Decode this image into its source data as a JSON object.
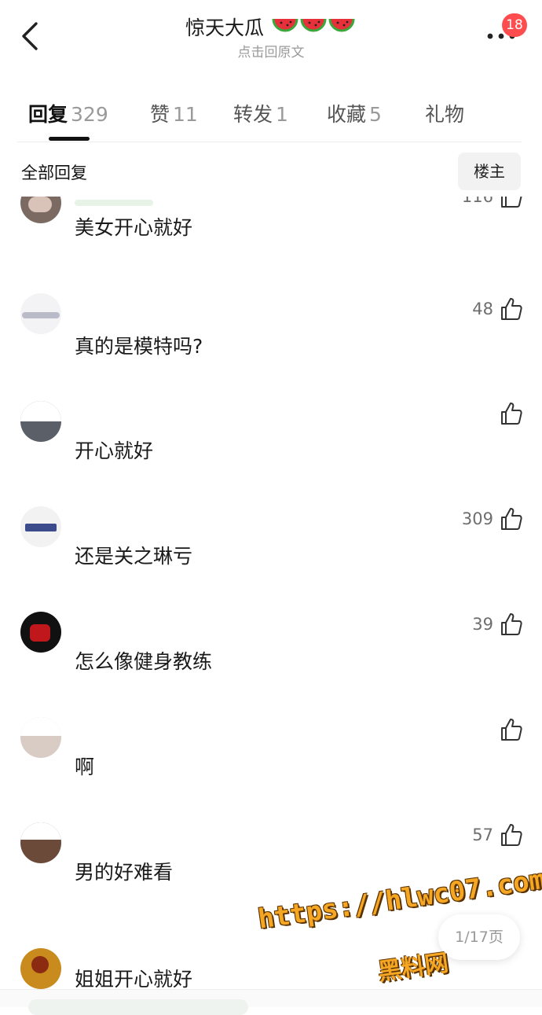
{
  "header": {
    "title": "惊天大瓜",
    "subtitle": "点击回原文",
    "notification_count": "18",
    "title_icons": [
      "watermelon-icon",
      "watermelon-icon",
      "watermelon-icon"
    ]
  },
  "tabs": [
    {
      "label": "回复",
      "count": "329",
      "active": true
    },
    {
      "label": "赞",
      "count": "11",
      "active": false
    },
    {
      "label": "转发",
      "count": "1",
      "active": false
    },
    {
      "label": "收藏",
      "count": "5",
      "active": false
    },
    {
      "label": "礼物",
      "count": "",
      "active": false
    }
  ],
  "filter": {
    "title": "全部回复",
    "op_label": "楼主"
  },
  "comments": [
    {
      "text": "美女开心就好",
      "likes": "116"
    },
    {
      "text": "真的是模特吗?",
      "likes": "48"
    },
    {
      "text": "开心就好",
      "likes": ""
    },
    {
      "text": "还是关之琳亏",
      "likes": "309"
    },
    {
      "text": "怎么像健身教练",
      "likes": "39"
    },
    {
      "text": "啊",
      "likes": ""
    },
    {
      "text": "男的好难看",
      "likes": "57"
    },
    {
      "text": "姐姐开心就好",
      "likes": ""
    }
  ],
  "pagination": {
    "label": "1/17页"
  },
  "watermark": {
    "url": "https://hlwc07.com",
    "name": "黑料网"
  },
  "colors": {
    "accent": "#111111",
    "badge": "#ff4d4f",
    "muted": "#9a9a9a",
    "watermark": "#f5a623"
  }
}
